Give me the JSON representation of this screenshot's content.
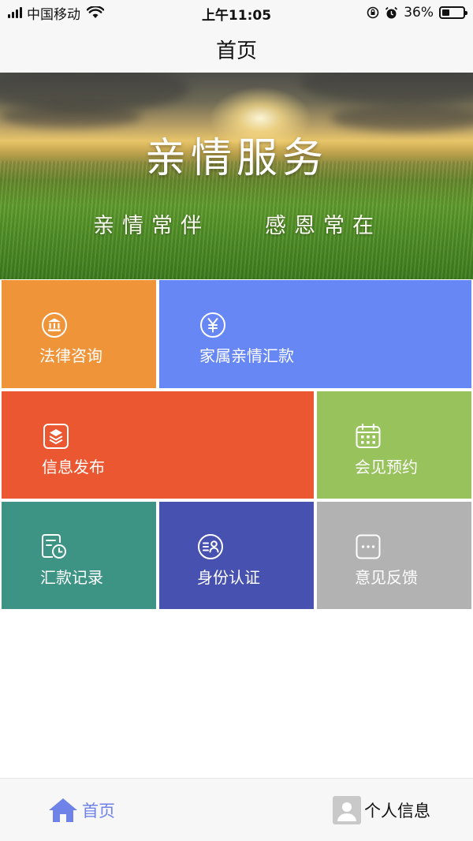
{
  "status_bar": {
    "carrier": "中国移动",
    "time": "上午11:05",
    "battery_percent": "36%",
    "battery_level": 0.36
  },
  "nav": {
    "title": "首页"
  },
  "banner": {
    "title": "亲情服务",
    "subtitle_left": "亲情常伴",
    "subtitle_right": "感恩常在"
  },
  "tiles": [
    {
      "label": "法律咨询",
      "color": "#f0943a",
      "icon": "bank-icon"
    },
    {
      "label": "家属亲情汇款",
      "color": "#6787f4",
      "icon": "yen-icon"
    },
    {
      "label": "信息发布",
      "color": "#ea5730",
      "icon": "layers-icon"
    },
    {
      "label": "会见预约",
      "color": "#97c25c",
      "icon": "calendar-icon"
    },
    {
      "label": "汇款记录",
      "color": "#3e9484",
      "icon": "record-clock-icon"
    },
    {
      "label": "身份认证",
      "color": "#4751b0",
      "icon": "id-card-icon"
    },
    {
      "label": "意见反馈",
      "color": "#b2b2b2",
      "icon": "message-icon"
    }
  ],
  "tab_bar": {
    "items": [
      {
        "label": "首页",
        "icon": "home-icon",
        "active": true,
        "color": "#6e82e8"
      },
      {
        "label": "个人信息",
        "icon": "person-icon",
        "active": false,
        "color": "#111111"
      }
    ]
  }
}
